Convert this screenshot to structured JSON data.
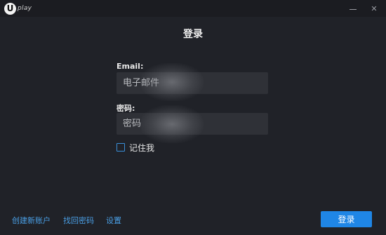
{
  "app": {
    "logo_text": "play",
    "logo_letter": "U"
  },
  "window_controls": {
    "minimize_icon": "minimize-icon",
    "close_glyph": "✕"
  },
  "form": {
    "title": "登录",
    "email_label": "Email:",
    "email_placeholder": "电子邮件",
    "password_label": "密码:",
    "password_placeholder": "密码",
    "remember_label": "记住我",
    "remember_checked": false
  },
  "footer": {
    "create_account": "创建新账户",
    "find_password": "找回密码",
    "settings": "设置",
    "login_button": "登录"
  },
  "colors": {
    "background": "#202228",
    "input_bg": "#2f3137",
    "link": "#4a9fe5",
    "accent": "#1f86e6"
  }
}
